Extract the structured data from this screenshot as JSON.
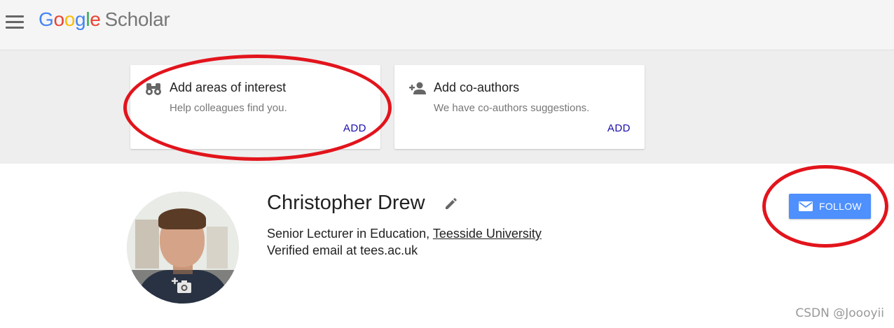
{
  "header": {
    "logo": {
      "letters": [
        "G",
        "o",
        "o",
        "g",
        "l",
        "e"
      ],
      "product": "Scholar"
    },
    "icons": {
      "menu": "hamburger-menu-icon"
    }
  },
  "cards": [
    {
      "icon": "binoculars-icon",
      "title": "Add areas of interest",
      "subtitle": "Help colleagues find you.",
      "action": "ADD"
    },
    {
      "icon": "add-person-icon",
      "title": "Add co-authors",
      "subtitle": "We have co-authors suggestions.",
      "action": "ADD"
    }
  ],
  "profile": {
    "name": "Christopher Drew",
    "affiliation_prefix": "Senior Lecturer in Education, ",
    "affiliation_link": "Teesside University",
    "email_line": "Verified email at tees.ac.uk",
    "icons": {
      "edit": "pencil-edit-icon",
      "avatar_upload": "add-photo-camera-icon"
    }
  },
  "follow_button": {
    "label": "FOLLOW",
    "icon": "envelope-icon"
  },
  "watermark": "CSDN @Joooyii",
  "colors": {
    "follow_button": "#4d90fe",
    "annotation_ellipse": "#e2141c",
    "link_blue": "#1a0dab",
    "google_blue": "#4285f4",
    "google_red": "#ea4335",
    "google_yellow": "#fbbc05",
    "google_green": "#34a853"
  }
}
